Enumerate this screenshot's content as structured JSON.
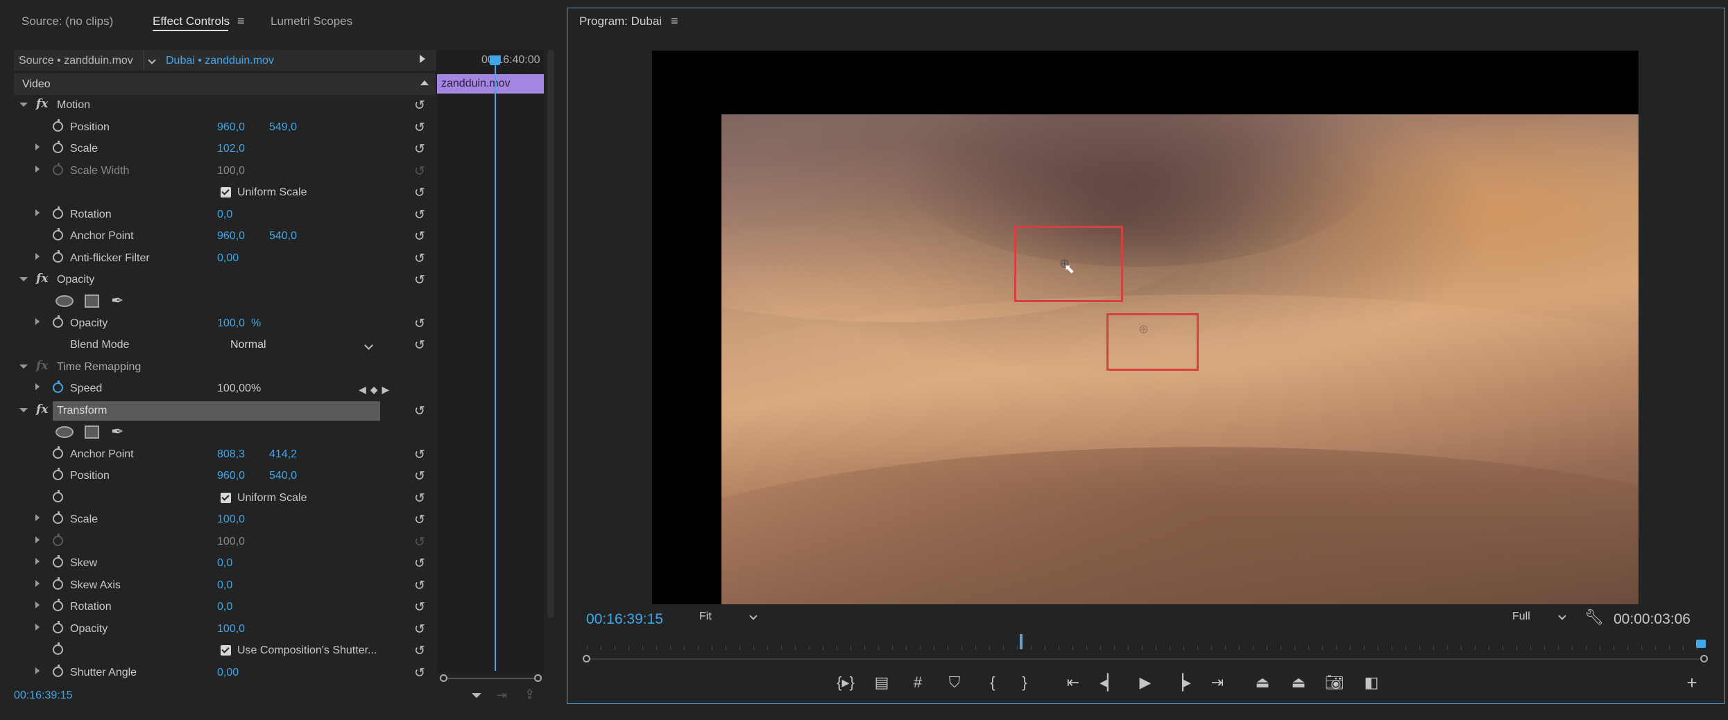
{
  "left_panel": {
    "tabs": [
      {
        "label": "Source: (no clips)"
      },
      {
        "label": "Effect Controls"
      },
      {
        "label": "Lumetri Scopes"
      }
    ],
    "source_label": "Source • zandduin.mov",
    "sequence_label": "Dubai • zandduin.mov",
    "timeline_timecode": "00:16:40:00",
    "clip_name": "zandduin.mov",
    "section": "Video",
    "rows": {
      "motion": "Motion",
      "position": {
        "label": "Position",
        "x": "960,0",
        "y": "549,0"
      },
      "scale": {
        "label": "Scale",
        "value": "102,0"
      },
      "scale_width": {
        "label": "Scale Width",
        "value": "100,0"
      },
      "uniform_scale": "Uniform Scale",
      "rotation": {
        "label": "Rotation",
        "value": "0,0"
      },
      "anchor": {
        "label": "Anchor Point",
        "x": "960,0",
        "y": "540,0"
      },
      "antiflicker": {
        "label": "Anti-flicker Filter",
        "value": "0,00"
      },
      "opacity_group": "Opacity",
      "opacity": {
        "label": "Opacity",
        "value": "100,0",
        "unit": "%"
      },
      "blend": {
        "label": "Blend Mode",
        "value": "Normal"
      },
      "time_remap": "Time Remapping",
      "speed": {
        "label": "Speed",
        "value": "100,00%"
      },
      "transform": "Transform",
      "t_anchor": {
        "label": "Anchor Point",
        "x": "808,3",
        "y": "414,2"
      },
      "t_position": {
        "label": "Position",
        "x": "960,0",
        "y": "540,0"
      },
      "t_uniform": "Uniform Scale",
      "t_scale": {
        "label": "Scale",
        "value": "100,0"
      },
      "t_scale_w": {
        "value": "100,0"
      },
      "t_skew": {
        "label": "Skew",
        "value": "0,0"
      },
      "t_skew_axis": {
        "label": "Skew Axis",
        "value": "0,0"
      },
      "t_rotation": {
        "label": "Rotation",
        "value": "0,0"
      },
      "t_opacity": {
        "label": "Opacity",
        "value": "100,0"
      },
      "t_shutter": "Use Composition's Shutter...",
      "t_shutter_angle": {
        "label": "Shutter Angle",
        "value": "0,00"
      }
    },
    "footer_timecode": "00:16:39:15"
  },
  "program": {
    "title": "Program: Dubai",
    "current_timecode": "00:16:39:15",
    "fit": "Fit",
    "resolution": "Full",
    "duration": "00:00:03:06"
  },
  "colors": {
    "accent": "#3fa7ea",
    "clip": "#a386e0",
    "tracking_box": "#d64040"
  },
  "icons": [
    "menu-icon",
    "stopwatch-icon",
    "reset-icon",
    "ellipse-mask-icon",
    "rectangle-mask-icon",
    "pen-mask-icon",
    "filter-icon",
    "play-icon",
    "camera-icon",
    "wrench-icon",
    "add-icon"
  ]
}
